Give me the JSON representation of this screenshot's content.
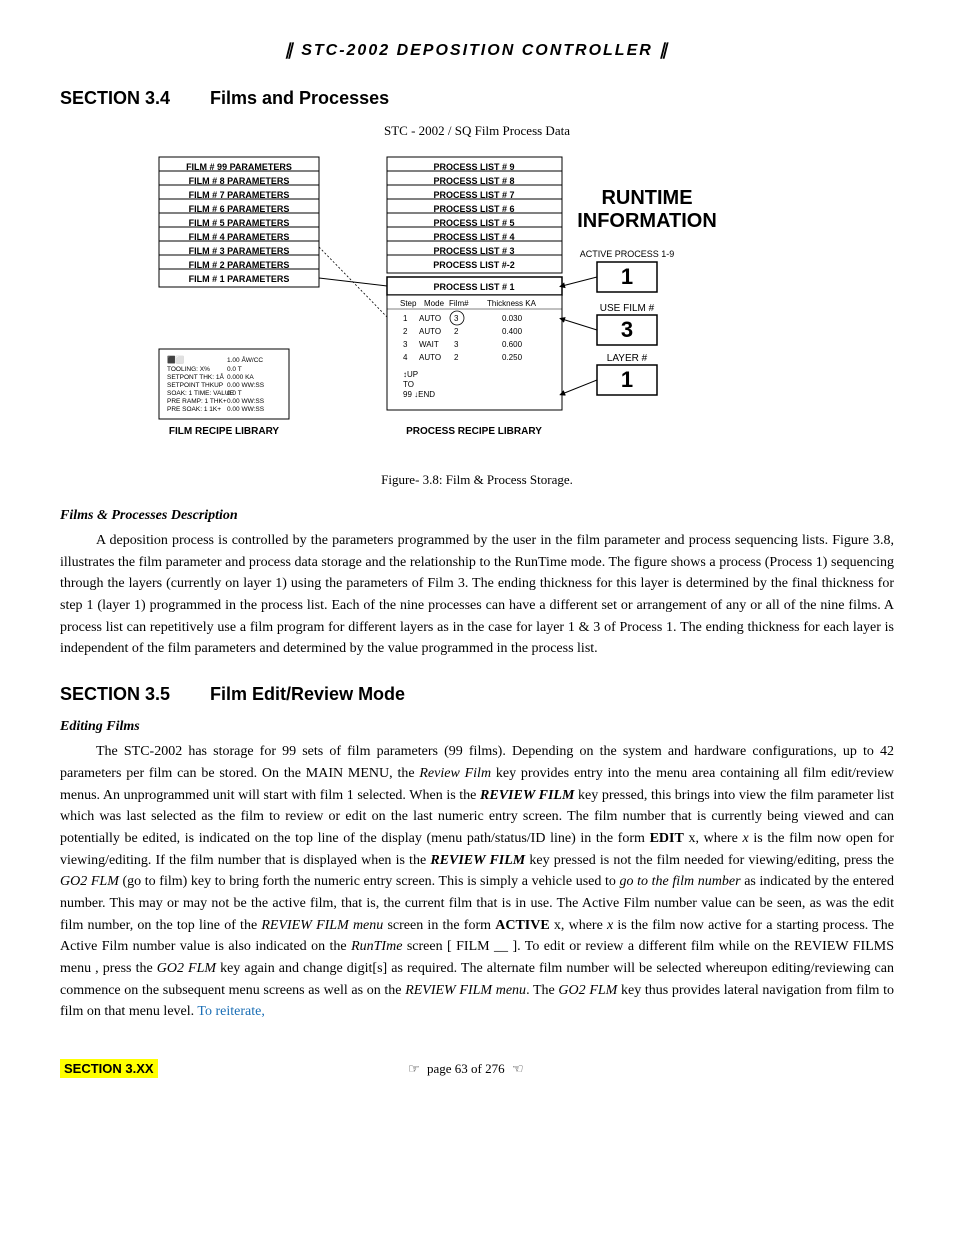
{
  "header": {
    "prefix": "✗✗ ",
    "title": "STC-2002  DEPOSITION CONTROLLER",
    "suffix": " ✗✗"
  },
  "section34": {
    "number": "SECTION 3.4",
    "title": "Films and Processes",
    "diagram_subtitle": "STC - 2002 / SQ Film Process Data",
    "figure_caption": "Figure- 3.8:  Film & Process Storage.",
    "subsection_title": "Films & Processes Description",
    "paragraph": "A deposition process is controlled by the parameters programmed by the user in the film parameter and process sequencing lists. Figure 3.8, illustrates the film parameter and process data storage and the relationship to the RunTime mode. The figure shows a process (Process 1) sequencing through the layers (currently on layer 1) using the parameters of Film 3. The ending thickness for this layer is determined by the final thickness for step 1 (layer 1) programmed in the process list. Each of the nine processes can have a different set or arrangement of any or all of the nine films. A process list can repetitively use a film program for different layers as in the case for layer 1 & 3 of Process 1. The ending thickness for each layer is independent of the film parameters and determined by the value programmed in the process list."
  },
  "section35": {
    "number": "SECTION 3.5",
    "title": "Film Edit/Review Mode",
    "subsection_title": "Editing Films",
    "paragraph1": "The STC-2002 has storage for 99 sets of film parameters (99 films).  Depending on the system and hardware configurations, up to 42 parameters per film can be stored. On the MAIN MENU, the ",
    "review_film_italic": "Review Film",
    "paragraph1b": " key provides entry into the menu area containing all film edit/review menus. An unprogrammed unit will start with film 1 selected. When is the ",
    "review_film_key": "REVIEW FILM",
    "paragraph1c": " key pressed, this brings into view the film parameter list which was last selected as the film to review or edit on the last numeric entry screen. The film number that is currently being viewed and can potentially be edited, is indicated on the top line of the display (menu path/status/ID line) in the form ",
    "edit_bold": "EDIT",
    "paragraph1d": "  x,",
    "paragraph1e": " where ",
    "x_italic": "x",
    "paragraph1f": " is the film now open for viewing/editing. If the film number that is displayed when is the ",
    "review_film_key2": "REVIEW FILM",
    "paragraph1g": " key pressed is not the film needed for viewing/editing, press the ",
    "go2flm_italic": "GO2 FLM",
    "paragraph1h": " (go to film) key to bring forth the numeric entry screen. This is simply a vehicle used to ",
    "go_italic": "go to the film number",
    "paragraph1i": " as indicated by the entered number. This may or may not be the active film, that is, the current film that is in use. The Active Film number value can be seen, as was the edit film number, on the top line of the ",
    "review_film_menu_italic": "REVIEW FILM menu",
    "paragraph1j": " screen in the form ",
    "active_bold": "ACTIVE",
    "paragraph1k": "  x,",
    "paragraph1l": " where ",
    "x2_italic": "x",
    "paragraph1m": " is the film now active for a starting process. The Active Film number value is also indicated on the ",
    "runtime_italic": "RunTIme",
    "paragraph1n": " screen [ FILM __ ]. To edit or review a different film while on the REVIEW FILMS menu , press the ",
    "go2flm2_italic": "GO2 FLM",
    "paragraph1o": " key again and change digit[s] as required.  The alternate film number will be selected whereupon editing/reviewing can commence on the subsequent menu screens as well as on the ",
    "review_film_menu2_italic": "REVIEW FILM menu",
    "paragraph1p": ". The ",
    "go2flm3_italic": "GO2 FLM",
    "paragraph1q": " key thus provides lateral navigation from film to film on that menu level. ",
    "to_reiterate_blue": "To reiterate,"
  },
  "footer": {
    "section_label": "SECTION 3.XX",
    "page_info": "page 63 of 276",
    "arrow_left": "☞",
    "arrow_right": "☜"
  },
  "diagram": {
    "film_params": [
      "FILM # 99 PARAMETERS",
      "FILM # 8 PARAMETERS",
      "FILM # 7 PARAMETERS",
      "FILM # 6 PARAMETERS",
      "FILM # 5 PARAMETERS",
      "FILM # 4 PARAMETERS",
      "FILM # 3 PARAMETERS",
      "FILM # 2 PARAMETERS",
      "FILM # 1 PARAMETERS"
    ],
    "process_lists": [
      "PROCESS LIST    # 9",
      "PROCESS LIST    # 8",
      "PROCESS LIST    # 7",
      "PROCESS LIST    # 6",
      "PROCESS LIST    # 5",
      "PROCESS LIST    # 4",
      "PROCESS LIST    # 3",
      "PROCESS LIST    #-2",
      "PROCESS LIST   # 1"
    ],
    "runtime_label": "RUNTIME\nINFORMATION",
    "active_process_label": "ACTIVE PROCESS  1-9",
    "active_process_value": "1",
    "use_film_label": "USE FILM #",
    "use_film_value": "3",
    "layer_label": "LAYER #",
    "layer_value": "1",
    "film_recipe_label": "FILM RECIPE LIBRARY",
    "process_recipe_label": "PROCESS RECIPE LIBRARY",
    "table_headers": [
      "Step",
      "Mode",
      "Film#",
      "Thickness KA"
    ],
    "table_rows": [
      [
        "1",
        "AUTO",
        "3",
        "0.030"
      ],
      [
        "2",
        "AUTO",
        "2",
        "0.400"
      ],
      [
        "3",
        "WAIT",
        "3",
        "0.600"
      ],
      [
        "4",
        "AUTO",
        "2",
        "0.250"
      ]
    ],
    "table_footer": [
      "UP",
      "TO",
      "99",
      "END"
    ]
  }
}
